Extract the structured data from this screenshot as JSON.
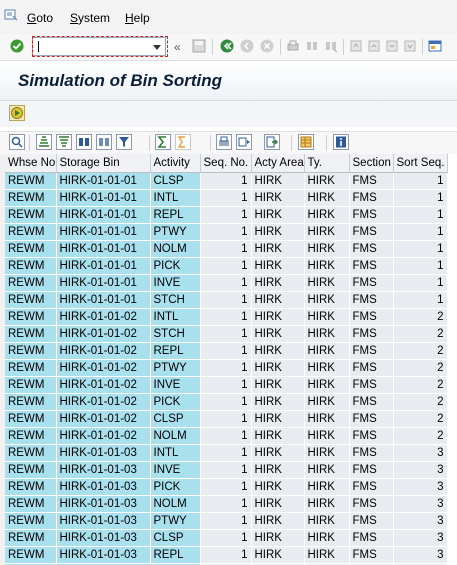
{
  "menu": {
    "goto": "Goto",
    "system": "System",
    "help": "Help"
  },
  "toolbar": {
    "command_value": "",
    "double_arrow": "«"
  },
  "title": "Simulation of Bin Sorting",
  "columns": [
    "Whse No.",
    "Storage Bin",
    "Activity",
    "Seq. No.",
    "Acty Area",
    "Ty.",
    "Section",
    "Sort Seq."
  ],
  "rows": [
    [
      "REWM",
      "HIRK-01-01-01",
      "CLSP",
      "1",
      "HIRK",
      "HIRK",
      "FMS",
      "1"
    ],
    [
      "REWM",
      "HIRK-01-01-01",
      "INTL",
      "1",
      "HIRK",
      "HIRK",
      "FMS",
      "1"
    ],
    [
      "REWM",
      "HIRK-01-01-01",
      "REPL",
      "1",
      "HIRK",
      "HIRK",
      "FMS",
      "1"
    ],
    [
      "REWM",
      "HIRK-01-01-01",
      "PTWY",
      "1",
      "HIRK",
      "HIRK",
      "FMS",
      "1"
    ],
    [
      "REWM",
      "HIRK-01-01-01",
      "NOLM",
      "1",
      "HIRK",
      "HIRK",
      "FMS",
      "1"
    ],
    [
      "REWM",
      "HIRK-01-01-01",
      "PICK",
      "1",
      "HIRK",
      "HIRK",
      "FMS",
      "1"
    ],
    [
      "REWM",
      "HIRK-01-01-01",
      "INVE",
      "1",
      "HIRK",
      "HIRK",
      "FMS",
      "1"
    ],
    [
      "REWM",
      "HIRK-01-01-01",
      "STCH",
      "1",
      "HIRK",
      "HIRK",
      "FMS",
      "1"
    ],
    [
      "REWM",
      "HIRK-01-01-02",
      "INTL",
      "1",
      "HIRK",
      "HIRK",
      "FMS",
      "2"
    ],
    [
      "REWM",
      "HIRK-01-01-02",
      "STCH",
      "1",
      "HIRK",
      "HIRK",
      "FMS",
      "2"
    ],
    [
      "REWM",
      "HIRK-01-01-02",
      "REPL",
      "1",
      "HIRK",
      "HIRK",
      "FMS",
      "2"
    ],
    [
      "REWM",
      "HIRK-01-01-02",
      "PTWY",
      "1",
      "HIRK",
      "HIRK",
      "FMS",
      "2"
    ],
    [
      "REWM",
      "HIRK-01-01-02",
      "INVE",
      "1",
      "HIRK",
      "HIRK",
      "FMS",
      "2"
    ],
    [
      "REWM",
      "HIRK-01-01-02",
      "PICK",
      "1",
      "HIRK",
      "HIRK",
      "FMS",
      "2"
    ],
    [
      "REWM",
      "HIRK-01-01-02",
      "CLSP",
      "1",
      "HIRK",
      "HIRK",
      "FMS",
      "2"
    ],
    [
      "REWM",
      "HIRK-01-01-02",
      "NOLM",
      "1",
      "HIRK",
      "HIRK",
      "FMS",
      "2"
    ],
    [
      "REWM",
      "HIRK-01-01-03",
      "INTL",
      "1",
      "HIRK",
      "HIRK",
      "FMS",
      "3"
    ],
    [
      "REWM",
      "HIRK-01-01-03",
      "INVE",
      "1",
      "HIRK",
      "HIRK",
      "FMS",
      "3"
    ],
    [
      "REWM",
      "HIRK-01-01-03",
      "PICK",
      "1",
      "HIRK",
      "HIRK",
      "FMS",
      "3"
    ],
    [
      "REWM",
      "HIRK-01-01-03",
      "NOLM",
      "1",
      "HIRK",
      "HIRK",
      "FMS",
      "3"
    ],
    [
      "REWM",
      "HIRK-01-01-03",
      "PTWY",
      "1",
      "HIRK",
      "HIRK",
      "FMS",
      "3"
    ],
    [
      "REWM",
      "HIRK-01-01-03",
      "CLSP",
      "1",
      "HIRK",
      "HIRK",
      "FMS",
      "3"
    ],
    [
      "REWM",
      "HIRK-01-01-03",
      "REPL",
      "1",
      "HIRK",
      "HIRK",
      "FMS",
      "3"
    ],
    [
      "REWM",
      "HIRK-01-01-03",
      "STCH",
      "1",
      "HIRK",
      "HIRK",
      "FMS",
      "3"
    ]
  ],
  "colors": {
    "key_cell": "#a9e0ee",
    "value_cell": "#e8ecf0",
    "title_text": "#0b1f36"
  }
}
